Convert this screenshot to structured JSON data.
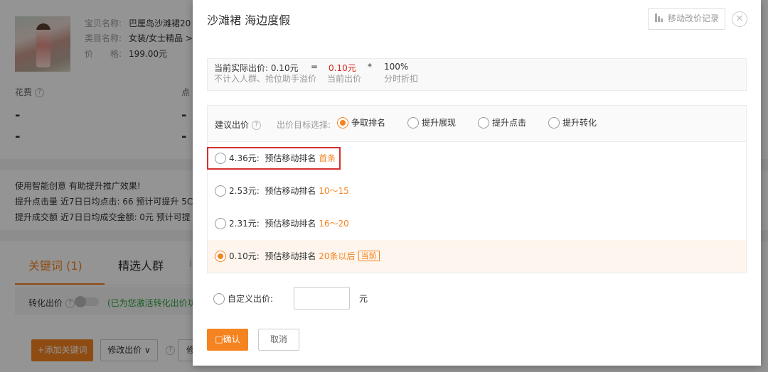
{
  "background": {
    "product": {
      "name_label": "宝贝名称:",
      "name_value": "巴厘岛沙滩裙20",
      "category_label": "类目名称:",
      "category_value": "女装/女士精品 >",
      "price_label": "价　　格:",
      "price_value": "199.00元"
    },
    "stats": {
      "spend_label": "花费",
      "click_label_partial": "点",
      "dash": "-"
    },
    "tips": {
      "line1": "使用智能创意  有助提升推广效果!",
      "line2": "提升点击量 近7日日均点击: 66    预计可提升 5C",
      "line3": "提升成交额 近7日日均成交金额: 0元    预计可提"
    },
    "tabs": [
      {
        "label": "关键词 (1)",
        "active": true
      },
      {
        "label": "精选人群",
        "active": false
      },
      {
        "label": "i",
        "active": false
      }
    ],
    "conversion": {
      "label": "转化出价",
      "note": "(已为您激活转化出价功"
    },
    "toolbar": {
      "add_keyword": "+添加关键词",
      "modify_bid": "修改出价",
      "cut_partial": "修"
    }
  },
  "modal": {
    "title": "沙滩裙 海边度假",
    "history_button": "移动改价记录",
    "close_symbol": "×",
    "price_summary": {
      "actual_label": "当前实际出价: 0.10元",
      "equals": "=",
      "current_value": "0.10元",
      "multiply": "*",
      "discount_value": "100%",
      "actual_sub": "不计入人群、抢位助手溢价",
      "current_sub": "当前出价",
      "discount_sub": "分时折扣"
    },
    "suggest": {
      "label": "建议出价",
      "goal_label": "出价目标选择:",
      "goals": [
        {
          "label": "争取排名",
          "selected": true
        },
        {
          "label": "提升展现",
          "selected": false
        },
        {
          "label": "提升点击",
          "selected": false
        },
        {
          "label": "提升转化",
          "selected": false
        }
      ],
      "options": [
        {
          "price": "4.36元:",
          "desc": "预估移动排名",
          "rank": "首条",
          "tag": "",
          "selected": false
        },
        {
          "price": "2.53元:",
          "desc": "预估移动排名",
          "rank": "10～15",
          "tag": "",
          "selected": false
        },
        {
          "price": "2.31元:",
          "desc": "预估移动排名",
          "rank": "16～20",
          "tag": "",
          "selected": false
        },
        {
          "price": "0.10元:",
          "desc": "预估移动排名",
          "rank": "20条以后",
          "tag": "当前",
          "selected": true
        }
      ]
    },
    "custom": {
      "label": "自定义出价:",
      "value": "",
      "unit": "元"
    },
    "buttons": {
      "confirm": "□确认",
      "cancel": "取消"
    }
  }
}
